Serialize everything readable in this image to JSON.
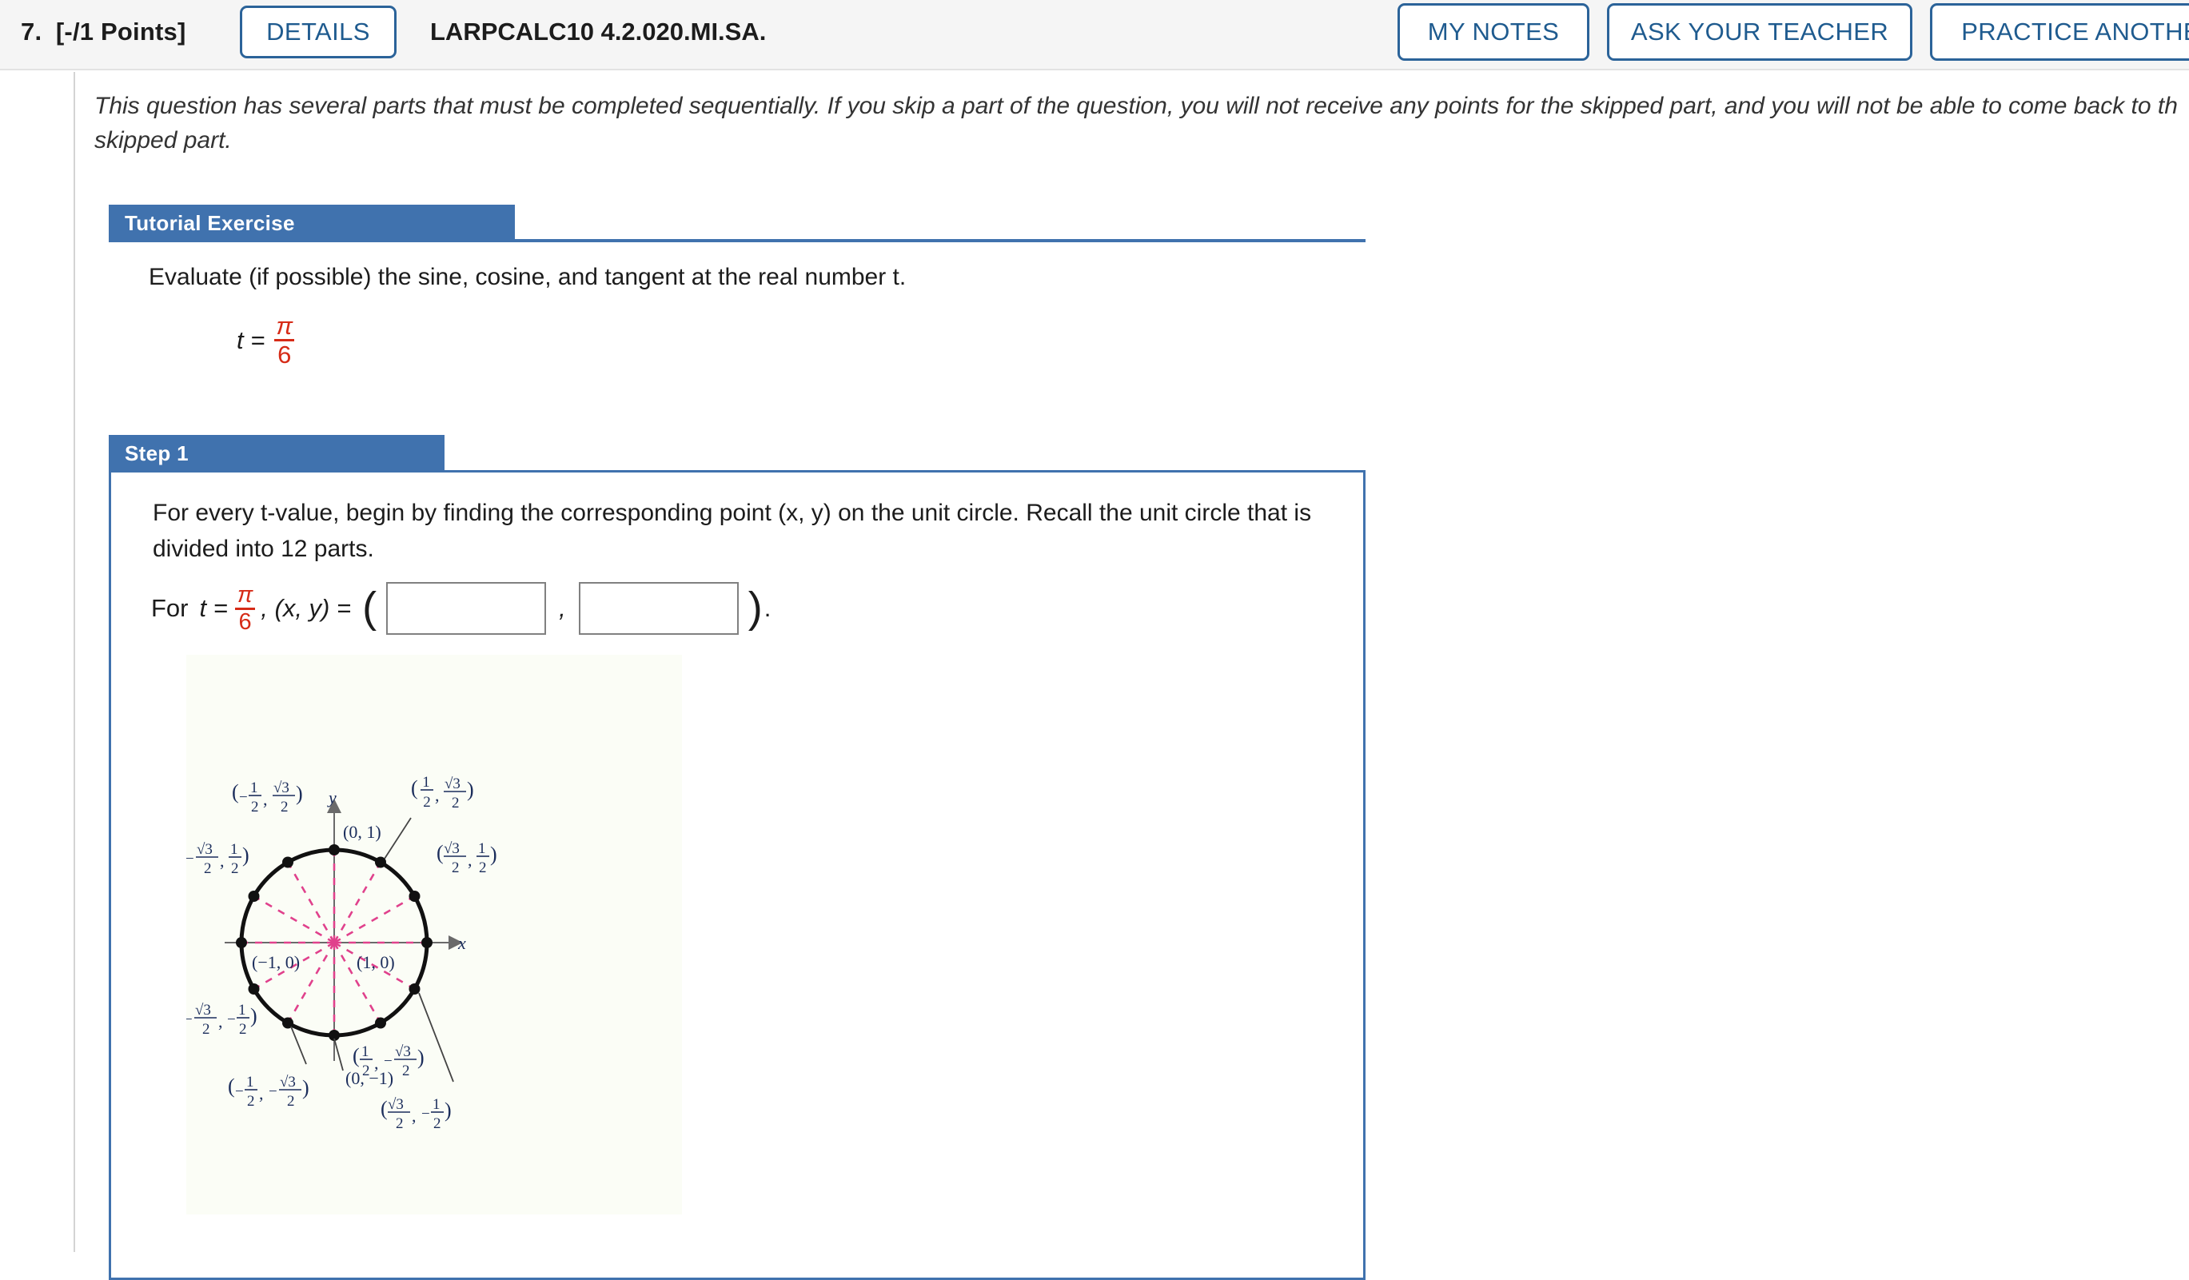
{
  "header": {
    "question_number": "7.",
    "points": "[-/1 Points]",
    "details_label": "DETAILS",
    "assignment_code": "LARPCALC10 4.2.020.MI.SA.",
    "my_notes_label": "MY NOTES",
    "ask_teacher_label": "ASK YOUR TEACHER",
    "practice_label": "PRACTICE ANOTHER",
    "accent_blue": "#2b6399",
    "bar_background": "#f5f5f5"
  },
  "intro": {
    "line1": "This question has several parts that must be completed sequentially. If you skip a part of the question, you will not receive any points for the skipped part, and you will not be able to come back to th",
    "line2": "skipped part."
  },
  "tutorial_exercise": {
    "tab_label": "Tutorial Exercise",
    "prompt": "Evaluate (if possible) the sine, cosine, and tangent at the real number t.",
    "equation": {
      "lhs": "t =",
      "numerator": "π",
      "denominator": "6",
      "color": "#d62b17"
    }
  },
  "step1": {
    "tab_label": "Step 1",
    "text_line1": "For every t-value, begin by finding the corresponding point (x, y) on the unit circle. Recall the unit circle that",
    "text_line2": "is divided into 12 parts.",
    "answer_prefix": "For",
    "t_label": "t =",
    "t_numerator": "π",
    "t_denominator": "6",
    "coord_label": ", (x, y) =",
    "open_paren": "(",
    "comma": ",",
    "close_paren": ")",
    "period": ".",
    "x_input_value": "",
    "y_input_value": "",
    "x_input_placeholder": "",
    "y_input_placeholder": ""
  },
  "figure": {
    "name": "unit-circle-12-parts",
    "x_axis_label": "x",
    "y_axis_label": "y",
    "background": "#fbfdf6",
    "circle_color": "#111111",
    "spoke_color": "#e0418c",
    "label_color": "#1b2d5b",
    "points": [
      {
        "id": "p-0",
        "angle_deg": 0,
        "label": "(1, 0)",
        "anchor": "inside-right"
      },
      {
        "id": "p-30",
        "angle_deg": 30,
        "label": "(√3/2, 1/2)",
        "anchor": "right"
      },
      {
        "id": "p-60",
        "angle_deg": 60,
        "label": "(1/2, √3/2)",
        "anchor": "upper-right"
      },
      {
        "id": "p-90",
        "angle_deg": 90,
        "label": "(0, 1)",
        "anchor": "top-right"
      },
      {
        "id": "p-120",
        "angle_deg": 120,
        "label": "(-1/2, √3/2)",
        "anchor": "upper-left"
      },
      {
        "id": "p-150",
        "angle_deg": 150,
        "label": "(-√3/2, 1/2)",
        "anchor": "left"
      },
      {
        "id": "p-180",
        "angle_deg": 180,
        "label": "(-1, 0)",
        "anchor": "inside-left"
      },
      {
        "id": "p-210",
        "angle_deg": 210,
        "label": "(-√3/2, -1/2)",
        "anchor": "left"
      },
      {
        "id": "p-240",
        "angle_deg": 240,
        "label": "(-1/2, -√3/2)",
        "anchor": "lower-left"
      },
      {
        "id": "p-270",
        "angle_deg": 270,
        "label": "(0, -1)",
        "anchor": "bottom"
      },
      {
        "id": "p-300",
        "angle_deg": 300,
        "label": "(1/2, -√3/2)",
        "anchor": "lower-right"
      },
      {
        "id": "p-330",
        "angle_deg": 330,
        "label": "(√3/2, -1/2)",
        "anchor": "right"
      }
    ]
  }
}
